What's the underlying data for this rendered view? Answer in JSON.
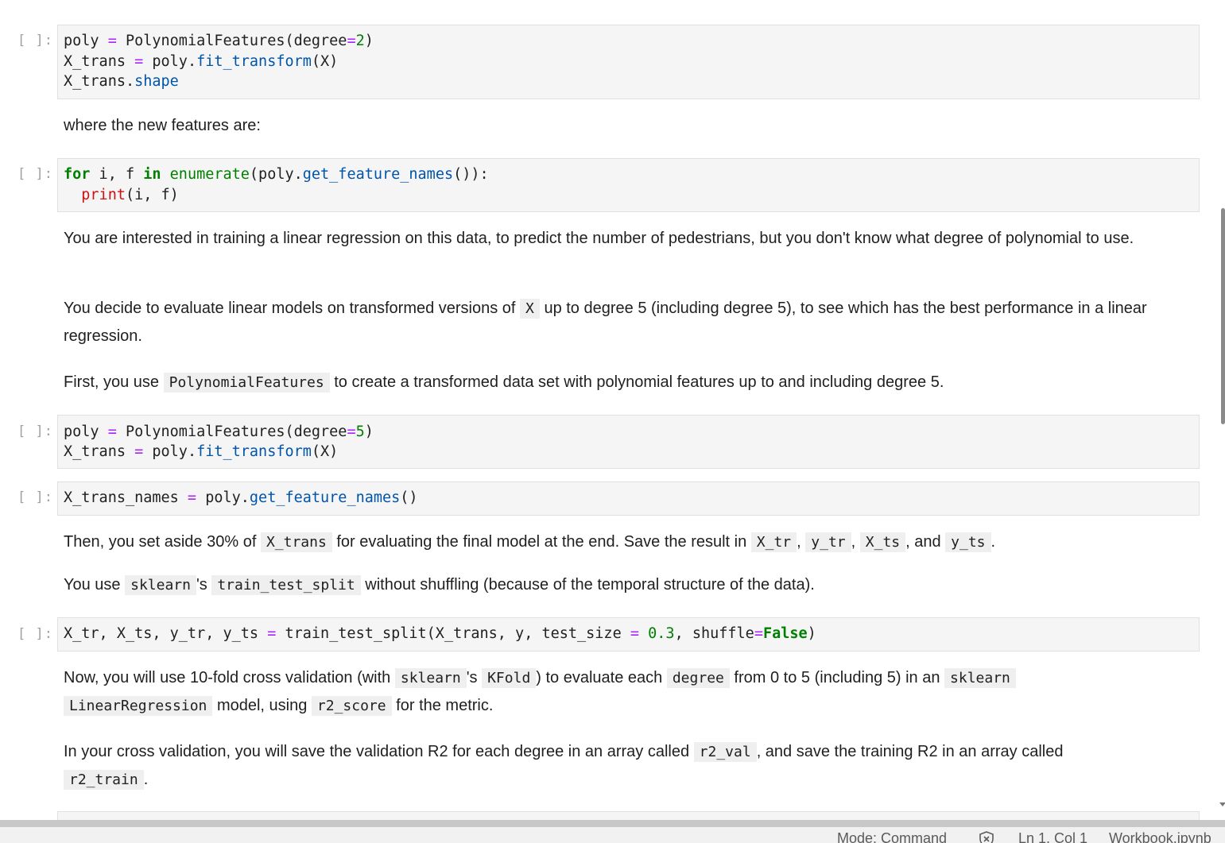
{
  "notebook": {
    "prompt": "[ ]:",
    "cells": {
      "c1": {
        "l1": [
          "poly",
          " = ",
          "PolynomialFeatures",
          "(degree",
          "=",
          "2",
          ")"
        ],
        "l2": [
          "X_trans",
          " = ",
          "poly.",
          "fit_transform",
          "(X)"
        ],
        "l3": [
          "X_trans.",
          "shape"
        ]
      },
      "m1": "where the new features are:",
      "c2": {
        "l1": [
          "for",
          " i, f ",
          "in",
          " ",
          "enumerate",
          "(poly.",
          "get_feature_names",
          "()):"
        ],
        "l2": [
          "  ",
          "print",
          "(i, f)"
        ]
      },
      "m2": "You are interested in training a linear regression on this data, to predict the number of pedestrians, but you don't know what degree of polynomial to use.",
      "m3": {
        "t1": "You decide to evaluate linear models on transformed versions of ",
        "c1": "X",
        "t2": " up to degree 5 (including degree 5), to see which has the best performance in a linear regression."
      },
      "m4": {
        "t1": "First, you use ",
        "c1": "PolynomialFeatures",
        "t2": " to create a transformed data set with polynomial features up to and including degree 5."
      },
      "c3": {
        "l1": [
          "poly",
          " = ",
          "PolynomialFeatures",
          "(degree",
          "=",
          "5",
          ")"
        ],
        "l2": [
          "X_trans",
          " = ",
          "poly.",
          "fit_transform",
          "(X)"
        ]
      },
      "c4": {
        "l1": [
          "X_trans_names",
          " = ",
          "poly.",
          "get_feature_names",
          "()"
        ]
      },
      "m5": {
        "t1": "Then, you set aside 30% of ",
        "c1": "X_trans",
        "t2": " for evaluating the final model at the end. Save the result in ",
        "c2": "X_tr",
        "t3": ", ",
        "c3": "y_tr",
        "t4": ", ",
        "c4": "X_ts",
        "t5": ", and ",
        "c5": "y_ts",
        "t6": "."
      },
      "m6": {
        "t1": "You use ",
        "c1": "sklearn",
        "t2": "'s ",
        "c2": "train_test_split",
        "t3": " without shuffling (because of the temporal structure of the data)."
      },
      "c5": {
        "l1": [
          "X_tr, X_ts, y_tr, y_ts ",
          "=",
          " train_test_split(X_trans, y, test_size ",
          "=",
          " ",
          "0.3",
          ", shuffle",
          "=",
          "False",
          ")"
        ]
      },
      "m7": {
        "t1": "Now, you will use 10-fold cross validation (with ",
        "c1": "sklearn",
        "t2": "'s ",
        "c2": "KFold",
        "t3": ") to evaluate each ",
        "c3": "degree",
        "t4": " from 0 to 5 (including 5) in an ",
        "c4": "sklearn",
        "t5": " ",
        "c5": "LinearRegression",
        "t6": " model, using ",
        "c6": "r2_score",
        "t7": " for the metric."
      },
      "m8": {
        "t1": "In your cross validation, you will save the validation R2 for each degree in an array called ",
        "c1": "r2_val",
        "t2": ", and save the training R2 in an array called ",
        "c2": "r2_train",
        "t3": "."
      }
    }
  },
  "statusbar": {
    "mode": "Mode: Command",
    "position": "Ln 1, Col 1",
    "file": "Workbook.ipynb"
  },
  "colors": {
    "keyword": "#008000",
    "function": "#0055aa",
    "operator": "#aa22ff",
    "print": "#d11111"
  }
}
